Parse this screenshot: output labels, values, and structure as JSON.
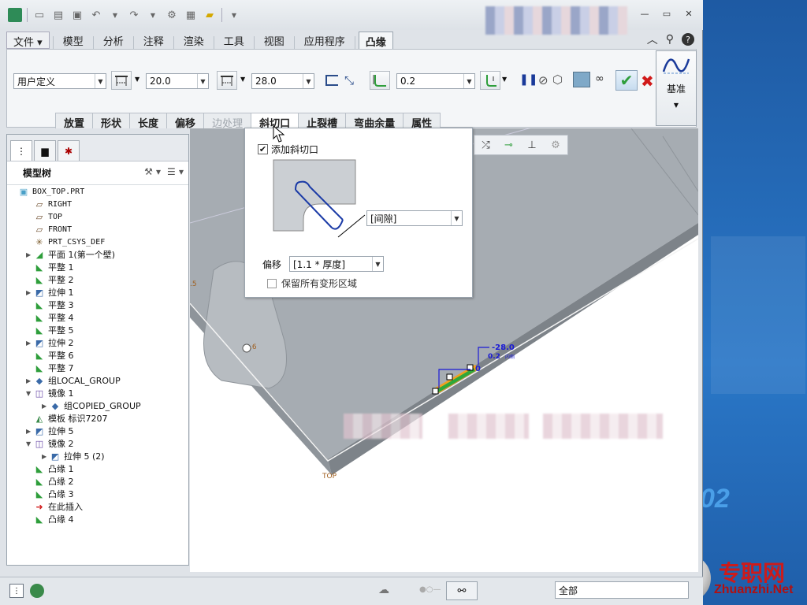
{
  "menubar": {
    "tabs": [
      "文件",
      "模型",
      "分析",
      "注释",
      "渲染",
      "工具",
      "视图",
      "应用程序",
      "凸缘"
    ],
    "active_tab": "凸缘"
  },
  "ribbon": {
    "shape_select": "用户定义",
    "length1": "20.0",
    "length2": "28.0",
    "thickness": "0.2",
    "datum_label": "基准",
    "subtabs": [
      "放置",
      "形状",
      "长度",
      "偏移",
      "边处理",
      "斜切口",
      "止裂槽",
      "弯曲余量",
      "属性"
    ],
    "active_subtab": "斜切口",
    "disabled_subtab": "边处理"
  },
  "sidebar": {
    "title": "模型树",
    "tree": [
      {
        "label": "BOX_TOP.PRT",
        "icon": "part-icon",
        "indent": 0,
        "exp": ""
      },
      {
        "label": "RIGHT",
        "icon": "plane-icon",
        "indent": 1,
        "exp": ""
      },
      {
        "label": "TOP",
        "icon": "plane-icon",
        "indent": 1,
        "exp": ""
      },
      {
        "label": "FRONT",
        "icon": "plane-icon",
        "indent": 1,
        "exp": ""
      },
      {
        "label": "PRT_CSYS_DEF",
        "icon": "csys-icon",
        "indent": 1,
        "exp": ""
      },
      {
        "label": "平面 1(第一个壁)",
        "icon": "wall-icon",
        "indent": 1,
        "exp": "▶"
      },
      {
        "label": "平整 1",
        "icon": "flat-icon",
        "indent": 1,
        "exp": ""
      },
      {
        "label": "平整 2",
        "icon": "flat-icon",
        "indent": 1,
        "exp": ""
      },
      {
        "label": "拉伸 1",
        "icon": "extrude-icon",
        "indent": 1,
        "exp": "▶"
      },
      {
        "label": "平整 3",
        "icon": "flat-icon",
        "indent": 1,
        "exp": ""
      },
      {
        "label": "平整 4",
        "icon": "flat-icon",
        "indent": 1,
        "exp": ""
      },
      {
        "label": "平整 5",
        "icon": "flat-icon",
        "indent": 1,
        "exp": ""
      },
      {
        "label": "拉伸 2",
        "icon": "extrude-icon",
        "indent": 1,
        "exp": "▶"
      },
      {
        "label": "平整 6",
        "icon": "flat-icon",
        "indent": 1,
        "exp": ""
      },
      {
        "label": "平整 7",
        "icon": "flat-icon",
        "indent": 1,
        "exp": ""
      },
      {
        "label": "组LOCAL_GROUP",
        "icon": "group-icon",
        "indent": 1,
        "exp": "▶"
      },
      {
        "label": "镜像 1",
        "icon": "mirror-icon",
        "indent": 1,
        "exp": "▼"
      },
      {
        "label": "组COPIED_GROUP",
        "icon": "group-icon",
        "indent": 2,
        "exp": "▶"
      },
      {
        "label": "模板 标识7207",
        "icon": "template-icon",
        "indent": 1,
        "exp": ""
      },
      {
        "label": "拉伸 5",
        "icon": "extrude-icon",
        "indent": 1,
        "exp": "▶"
      },
      {
        "label": "镜像 2",
        "icon": "mirror-icon",
        "indent": 1,
        "exp": "▼"
      },
      {
        "label": "拉伸 5 (2)",
        "icon": "extrude-icon",
        "indent": 2,
        "exp": "▶"
      },
      {
        "label": "凸缘 1",
        "icon": "flange-icon",
        "indent": 1,
        "exp": ""
      },
      {
        "label": "凸缘 2",
        "icon": "flange-icon",
        "indent": 1,
        "exp": ""
      },
      {
        "label": "凸缘 3",
        "icon": "flange-icon",
        "indent": 1,
        "exp": ""
      },
      {
        "label": "在此插入",
        "icon": "insert-arrow-icon",
        "indent": 1,
        "exp": ""
      },
      {
        "label": "凸缘 4",
        "icon": "flange-new-icon",
        "indent": 1,
        "exp": ""
      }
    ]
  },
  "popup": {
    "checkbox_label": "添加斜切口",
    "checked": true,
    "gap_select": "[间隙]",
    "offset_label": "偏移",
    "offset_select": "[1.1 * 厚度]",
    "keep_label": "保留所有变形区域",
    "keep_checked": false
  },
  "viewport": {
    "dim1": "-28.0",
    "dim2": "0.2",
    "dim2_suffix": "内侧",
    "dim3": "0",
    "label_5": ".5",
    "label_6": ".6",
    "top_label": "TOP"
  },
  "statusbar": {
    "filter_value": "全部"
  },
  "watermark": {
    "number": "02",
    "chinese": "专职网",
    "english": "Zhuanzhi.Net"
  },
  "colors": {
    "accent_green": "#2e9e3b",
    "cancel_red": "#d11a1a",
    "dim_blue": "#1a1ad6",
    "model_gray": "#a6acb2"
  }
}
